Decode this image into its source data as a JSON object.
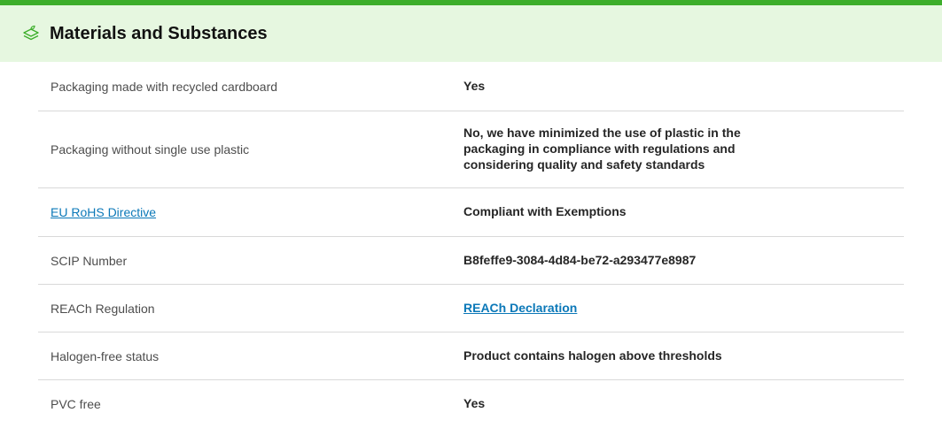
{
  "section": {
    "icon": "leaf-layers-icon",
    "title": "Materials and Substances",
    "accent_color": "#3dae2b",
    "header_bg": "#e6f7e0"
  },
  "rows": [
    {
      "label": "Packaging made with recycled cardboard",
      "value": "Yes"
    },
    {
      "label": "Packaging without single use plastic",
      "value_lines": [
        "No, we have minimized the use of plastic in the",
        "packaging in compliance with regulations and",
        "considering quality and safety standards"
      ]
    },
    {
      "label": "EU RoHS Directive",
      "value": "Compliant with Exemptions"
    },
    {
      "label": "SCIP Number",
      "value": "B8feffe9-3084-4d84-be72-a293477e8987"
    },
    {
      "label": "REACh Regulation",
      "value": "REACh Declaration"
    },
    {
      "label": "Halogen-free status",
      "value": "Product contains halogen above thresholds"
    },
    {
      "label": "PVC free",
      "value": "Yes"
    }
  ]
}
